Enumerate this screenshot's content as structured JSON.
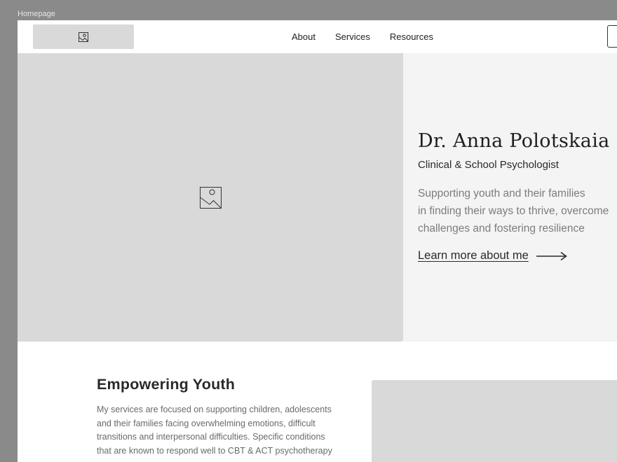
{
  "frame": {
    "label": "Homepage"
  },
  "nav": {
    "links": [
      "About",
      "Services",
      "Resources"
    ]
  },
  "hero": {
    "name": "Dr. Anna Polotskaia",
    "role": "Clinical & School Psychologist",
    "tagline": [
      "Supporting youth and their families",
      "in finding their ways to thrive, overcome",
      "challenges and fostering resilience"
    ],
    "link_label": "Learn more about me"
  },
  "section": {
    "title": "Empowering Youth",
    "body": [
      "My  services are focused on supporting children, adolescents",
      "and their families facing overwhelming emotions, difficult",
      "transitions and interpersonal difficulties. Specific conditions",
      "that are known to respond well to CBT & ACT psychotherapy"
    ]
  },
  "icons": {
    "logo": "image-placeholder-icon",
    "hero_image": "image-placeholder-icon",
    "link_arrow": "long-arrow-right-icon"
  },
  "colors": {
    "canvas": "#8a8a8a",
    "placeholder": "#d9d9d9",
    "hero_panel": "#f4f4f4",
    "text": "#222222",
    "muted_text": "#7c7c7c"
  }
}
